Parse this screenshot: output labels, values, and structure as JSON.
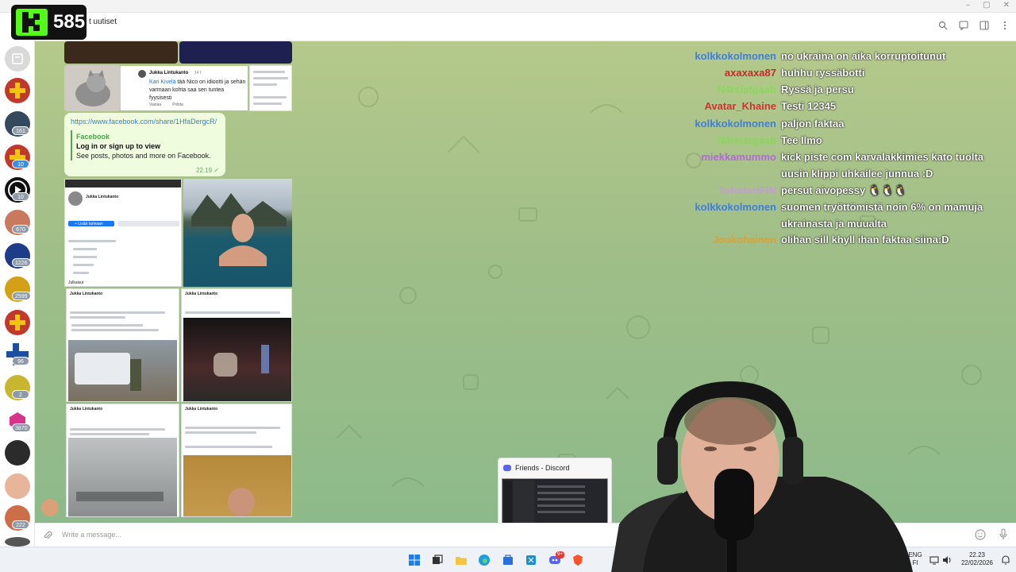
{
  "window": {
    "title": "t uutiset",
    "controls": [
      "–",
      "▢",
      "✕"
    ]
  },
  "logo": {
    "viewer_count": "585"
  },
  "sidebar": {
    "badges": [
      "161",
      "10",
      "10",
      "670",
      "1226",
      "2599",
      "96",
      "2",
      "3870",
      "222"
    ]
  },
  "messages": {
    "comment": {
      "author": "Jukka Lintukanto",
      "time": "14 t",
      "mention": "Kari Kivelä",
      "text": "tää Nico on idiootti ja sehän varmaan kohta saa sen tuntea fyysisesti",
      "actions": [
        "Vastaa",
        "Piilota"
      ]
    },
    "link_bubble": {
      "url": "https://www.facebook.com/share/1HfaDergcR/",
      "site": "Facebook",
      "title": "Log in or sign up to view",
      "description": "See posts, photos and more on Facebook.",
      "time": "22.19"
    },
    "profile_shot": {
      "name": "Jukka Lintukanto",
      "button": "+ Lisää tarinaan",
      "tab": "Julkaisut"
    },
    "post_author": "Jukka Lintukanto"
  },
  "stream_chat": [
    {
      "user": "kolkkokolmonen",
      "color": "#3f7fd8",
      "text": "no ukraina on aika korruptoitunut"
    },
    {
      "user": "axaxaxa87",
      "color": "#c42a2a",
      "text": "huhhu ryssäbotti"
    },
    {
      "user": "N4rsistgaab",
      "color": "#8ad65a",
      "text": "Ryssä ja persu"
    },
    {
      "user": "Avatar_Khaine",
      "color": "#d23131",
      "text": "Testi 12345"
    },
    {
      "user": "kolkkokolmonen",
      "color": "#3f7fd8",
      "text": "paljon faktaa"
    },
    {
      "user": "N4rsistgaab",
      "color": "#8ad65a",
      "text": "Tee Ilmo"
    },
    {
      "user": "miekkamummo",
      "color": "#b26ad8",
      "text": "kick piste com karvalakkimies kato tuolta uusin klippi uhkailee junnua :D"
    },
    {
      "user": "TohotoriFIN",
      "color": "#c79ad8",
      "text": "persut aivopessy 🐧🐧🐧"
    },
    {
      "user": "kolkkokolmonen",
      "color": "#3f7fd8",
      "text": "suomen tryöttömistä noin 6% on mamuja ukrainasta ja muualta"
    },
    {
      "user": "Joukohainen",
      "color": "#e0a030",
      "text": "olihan sill khyll ihan faktaa siina:D"
    }
  ],
  "discord_thumb": {
    "title": "Friends - Discord"
  },
  "composer": {
    "placeholder": "Write a message..."
  },
  "taskbar": {
    "lang_top": "ENG",
    "lang_bottom": "FI",
    "time": "22.23",
    "date": "22/02/2026",
    "discord_badge": "9+"
  }
}
